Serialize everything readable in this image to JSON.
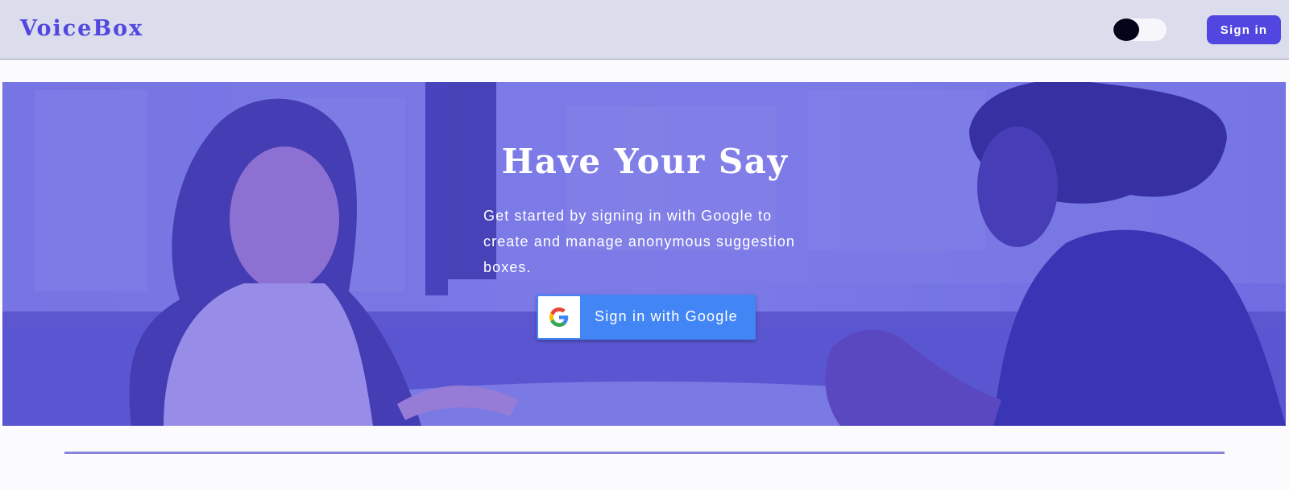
{
  "navbar": {
    "brand": "VoiceBox",
    "signin_label": "Sign in",
    "theme_toggle": {
      "state": "off"
    }
  },
  "hero": {
    "title": "Have Your Say",
    "subtitle": "Get started by signing in with Google to create and manage anonymous suggestion boxes.",
    "google_button_label": "Sign in with Google"
  },
  "icons": {
    "google": "google-g-icon",
    "theme": "theme-toggle-icon"
  },
  "colors": {
    "brand": "#5147e0",
    "navbar_bg": "#dbdcec",
    "hero_tint": "#6f6bd8",
    "google_blue": "#4285f4",
    "divider": "#8985de"
  }
}
